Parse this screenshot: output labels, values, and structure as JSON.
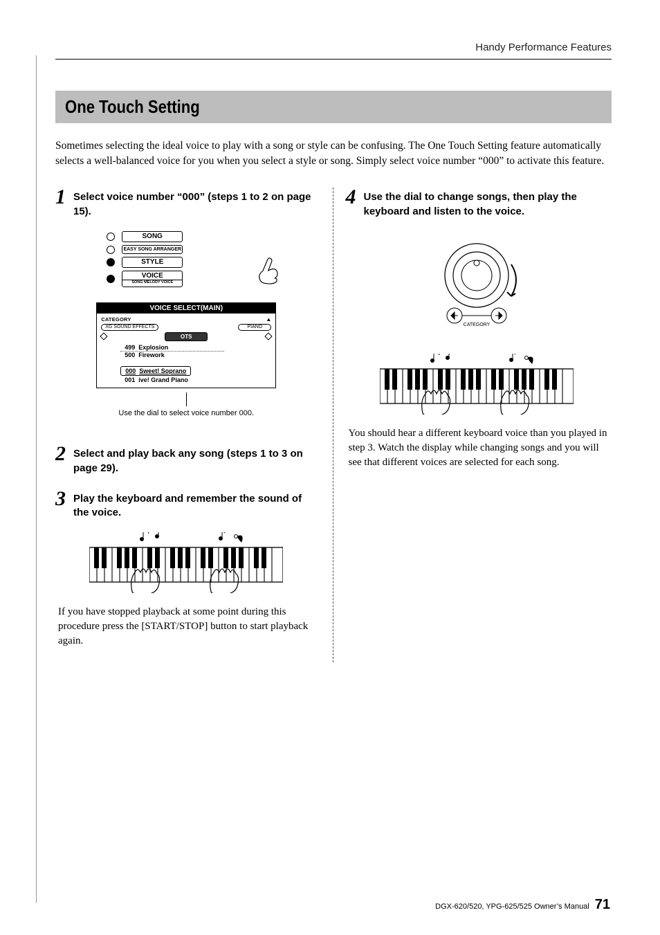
{
  "header": {
    "chapter": "Handy Performance Features"
  },
  "section": {
    "title": "One Touch Setting"
  },
  "intro": "Sometimes selecting the ideal voice to play with a song or style can be confusing. The One Touch Setting feature automatically selects a well-balanced voice for you when you select a style or song. Simply select voice number “000” to activate this feature.",
  "steps": {
    "1": {
      "num": "1",
      "text": "Select voice number “000” (steps 1 to 2 on page 15)."
    },
    "2": {
      "num": "2",
      "text": "Select and play back any song (steps 1 to 3 on page 29)."
    },
    "3": {
      "num": "3",
      "text": "Play the keyboard and remember the sound of the voice."
    },
    "4": {
      "num": "4",
      "text": "Use the dial to change songs, then play the keyboard and listen to the voice."
    }
  },
  "buttons": {
    "song": "SONG",
    "easy": "EASY SONG ARRANGER",
    "style": "STYLE",
    "voice": "VOICE",
    "melody_sub": "SONG MELODY VOICE"
  },
  "lcd": {
    "header": "VOICE SELECT(MAIN)",
    "category": "CATEGORY",
    "left_cat": "XG SOUND EFFECTS",
    "right_cat": "PIANO",
    "center": "OTS",
    "rows": [
      {
        "num": "499",
        "name": "Explosion"
      },
      {
        "num": "500",
        "name": "Firework"
      },
      {
        "num": "000",
        "name": "Sweet! Soprano"
      },
      {
        "num": "001",
        "name": "ive! Grand Piano"
      }
    ]
  },
  "caption1": "Use the dial to select voice number 000.",
  "body3": "If you have stopped playback at some point during this procedure press the [START/STOP] button to start playback again.",
  "body4": "You should hear a different keyboard voice than you played in step 3. Watch the display while changing songs and you will see that different voices are selected for each song.",
  "dial": {
    "category": "CATEGORY"
  },
  "footer": {
    "model": "DGX-620/520, YPG-625/525  Owner’s Manual",
    "page": "71"
  }
}
